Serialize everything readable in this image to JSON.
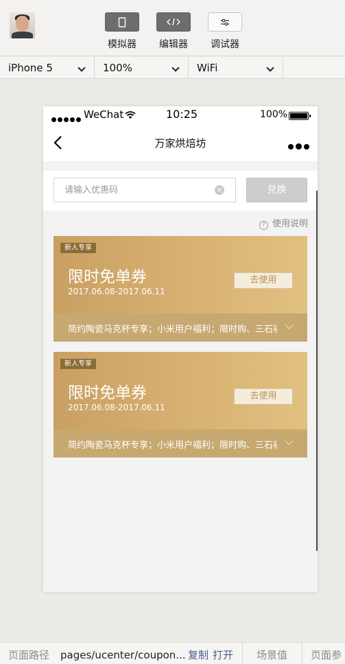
{
  "toolbar": {
    "tools": [
      {
        "label": "模拟器",
        "icon": "phone-icon"
      },
      {
        "label": "编辑器",
        "icon": "code-icon"
      },
      {
        "label": "调试器",
        "icon": "sliders-icon"
      }
    ]
  },
  "device_bar": {
    "device": "iPhone 5",
    "zoom": "100%",
    "network": "WiFi"
  },
  "status_bar": {
    "carrier": "WeChat",
    "time": "10:25",
    "battery": "100%"
  },
  "nav": {
    "title": "万家烘焙坊"
  },
  "redeem": {
    "placeholder": "请输入优惠码",
    "button": "兑换"
  },
  "help": {
    "label": "使用说明"
  },
  "coupons": [
    {
      "badge": "新人专享",
      "title": "限时免单券",
      "date": "2017.06.08-2017.06.11",
      "action": "去使用",
      "scope": "简约陶瓷马克杯专享；小米用户福利；限时购、三石福"
    },
    {
      "badge": "新人专享",
      "title": "限时免单券",
      "date": "2017.06.08-2017.06.11",
      "action": "去使用",
      "scope": "简约陶瓷马克杯专享；小米用户福利；限时购、三石福"
    }
  ],
  "bottom_bar": {
    "path_label": "页面路径",
    "path": "pages/ucenter/coupon...",
    "copy": "复制",
    "open": "打开",
    "scene": "场景值",
    "params": "页面参数"
  },
  "colors": {
    "coupon_gold": "#d8b273",
    "coupon_strip": "#c7a870",
    "badge": "#8a6d33"
  }
}
